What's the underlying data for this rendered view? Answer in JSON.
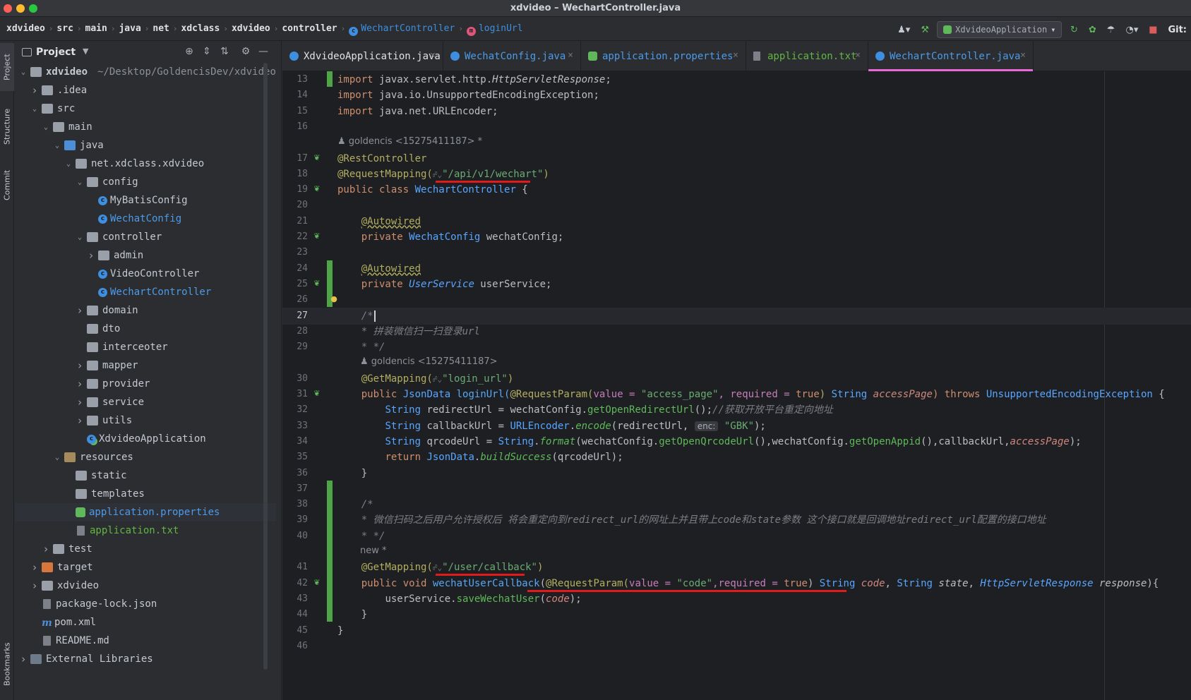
{
  "window": {
    "title": "xdvideo – WechartController.java"
  },
  "breadcrumb": [
    "xdvideo",
    "src",
    "main",
    "java",
    "net",
    "xdclass",
    "xdvideo",
    "controller",
    "WechartController",
    "loginUrl"
  ],
  "toolbar": {
    "run_config": "XdvideoApplication",
    "git_label": "Git:"
  },
  "toolstrip": {
    "project": "Project",
    "structure": "Structure",
    "commit": "Commit",
    "bookmarks": "Bookmarks"
  },
  "project_panel": {
    "title": "Project",
    "tree": [
      {
        "label": "xdvideo",
        "suffix": "~/Desktop/GoldencisDev/xdvideo",
        "depth": 0,
        "chevron": "down",
        "icon": "module-folder",
        "color": "normal"
      },
      {
        "label": ".idea",
        "depth": 1,
        "chevron": "right",
        "icon": "folder",
        "color": "normal"
      },
      {
        "label": "src",
        "depth": 1,
        "chevron": "down",
        "icon": "folder",
        "color": "normal"
      },
      {
        "label": "main",
        "depth": 2,
        "chevron": "down",
        "icon": "folder",
        "color": "normal"
      },
      {
        "label": "java",
        "depth": 3,
        "chevron": "down",
        "icon": "folder-blue",
        "color": "normal"
      },
      {
        "label": "net.xdclass.xdvideo",
        "depth": 4,
        "chevron": "down",
        "icon": "package",
        "color": "normal"
      },
      {
        "label": "config",
        "depth": 5,
        "chevron": "down",
        "icon": "package",
        "color": "normal"
      },
      {
        "label": "MyBatisConfig",
        "depth": 6,
        "chevron": "none",
        "icon": "class",
        "color": "normal"
      },
      {
        "label": "WechatConfig",
        "depth": 6,
        "chevron": "none",
        "icon": "class",
        "color": "blue"
      },
      {
        "label": "controller",
        "depth": 5,
        "chevron": "down",
        "icon": "package",
        "color": "normal"
      },
      {
        "label": "admin",
        "depth": 6,
        "chevron": "right",
        "icon": "package",
        "color": "normal"
      },
      {
        "label": "VideoController",
        "depth": 6,
        "chevron": "none",
        "icon": "class",
        "color": "normal"
      },
      {
        "label": "WechartController",
        "depth": 6,
        "chevron": "none",
        "icon": "class",
        "color": "blue"
      },
      {
        "label": "domain",
        "depth": 5,
        "chevron": "right",
        "icon": "package",
        "color": "normal"
      },
      {
        "label": "dto",
        "depth": 5,
        "chevron": "none",
        "icon": "package",
        "color": "normal"
      },
      {
        "label": "interceoter",
        "depth": 5,
        "chevron": "none",
        "icon": "package",
        "color": "normal"
      },
      {
        "label": "mapper",
        "depth": 5,
        "chevron": "right",
        "icon": "package",
        "color": "normal"
      },
      {
        "label": "provider",
        "depth": 5,
        "chevron": "right",
        "icon": "package",
        "color": "normal"
      },
      {
        "label": "service",
        "depth": 5,
        "chevron": "right",
        "icon": "package",
        "color": "normal"
      },
      {
        "label": "utils",
        "depth": 5,
        "chevron": "right",
        "icon": "package",
        "color": "normal"
      },
      {
        "label": "XdvideoApplication",
        "depth": 5,
        "chevron": "none",
        "icon": "spring-class",
        "color": "normal"
      },
      {
        "label": "resources",
        "depth": 3,
        "chevron": "down",
        "icon": "folder-res",
        "color": "normal"
      },
      {
        "label": "static",
        "depth": 4,
        "chevron": "none",
        "icon": "folder",
        "color": "normal"
      },
      {
        "label": "templates",
        "depth": 4,
        "chevron": "none",
        "icon": "folder",
        "color": "normal"
      },
      {
        "label": "application.properties",
        "depth": 4,
        "chevron": "none",
        "icon": "leaf",
        "color": "blue",
        "selected": true
      },
      {
        "label": "application.txt",
        "depth": 4,
        "chevron": "none",
        "icon": "file",
        "color": "green"
      },
      {
        "label": "test",
        "depth": 2,
        "chevron": "right",
        "icon": "folder",
        "color": "normal"
      },
      {
        "label": "target",
        "depth": 1,
        "chevron": "right",
        "icon": "folder-orange",
        "color": "normal"
      },
      {
        "label": "xdvideo",
        "depth": 1,
        "chevron": "right",
        "icon": "folder",
        "color": "normal"
      },
      {
        "label": "package-lock.json",
        "depth": 1,
        "chevron": "none",
        "icon": "file",
        "color": "normal"
      },
      {
        "label": "pom.xml",
        "depth": 1,
        "chevron": "none",
        "icon": "maven",
        "color": "normal"
      },
      {
        "label": "README.md",
        "depth": 1,
        "chevron": "none",
        "icon": "file",
        "color": "normal"
      },
      {
        "label": "External Libraries",
        "depth": 0,
        "chevron": "right",
        "icon": "library",
        "color": "normal"
      }
    ]
  },
  "tabs": [
    {
      "label": "XdvideoApplication.java",
      "icon": "spring-class",
      "color": "#dfe1e5"
    },
    {
      "label": "WechatConfig.java",
      "icon": "class",
      "color": "#4d9be8"
    },
    {
      "label": "application.properties",
      "icon": "leaf",
      "color": "#4d9be8"
    },
    {
      "label": "application.txt",
      "icon": "file",
      "color": "#62b543"
    },
    {
      "label": "WechartController.java",
      "icon": "class",
      "color": "#4d9be8",
      "active": true
    }
  ],
  "editor": {
    "current_line": 27,
    "author_hint_1": "goldencis <15275411187> *",
    "author_hint_2": "goldencis <15275411187>",
    "line_numbers": [
      "13",
      "14",
      "15",
      "16",
      "17",
      "18",
      "19",
      "20",
      "21",
      "22",
      "23",
      "24",
      "25",
      "26",
      "27",
      "28",
      "29",
      "30",
      "31",
      "32",
      "33",
      "34",
      "35",
      "36",
      "37",
      "38",
      "39",
      "40",
      "41",
      "42",
      "43",
      "44",
      "45",
      "46"
    ],
    "code": {
      "l13": "import javax.servlet.http.",
      "l13b": "HttpServletResponse",
      "l13c": ";",
      "l14": "import java.io.UnsupportedEncodingException;",
      "l15": "import java.net.URLEncoder;",
      "l17": "@RestController",
      "l18a": "@RequestMapping(",
      "l18b": "\"/api/v1/wechart\"",
      "l18c": ")",
      "l19a": "public class ",
      "l19b": "WechartController",
      "l19c": " {",
      "l21": "@Autowired",
      "l22a": "private ",
      "l22b": "WechatConfig",
      "l22c": " wechatConfig;",
      "l24": "@Autowired",
      "l25a": "private ",
      "l25b": "UserService",
      "l25c": " userService;",
      "l27": "/*",
      "l28": "* 拼装微信扫一扫登录url",
      "l29": "* */",
      "l30a": "@GetMapping(",
      "l30b": "\"login_url\"",
      "l30c": ")",
      "l31a": "public ",
      "l31b": "JsonData",
      "l31c": " loginUrl(",
      "l31d": "@RequestParam(",
      "l31e": "value = ",
      "l31f": "\"access_page\"",
      "l31g": ", required = ",
      "l31h": "true",
      "l31i": ") ",
      "l31j": "String",
      "l31k": " accessPage",
      "l31l": ") throws ",
      "l31m": "UnsupportedEncodingException",
      "l31n": " {",
      "l32a": "String",
      "l32b": " redirectUrl = wechatConfig.",
      "l32c": "getOpenRedirectUrl",
      "l32d": "();",
      "l32e": "//获取开放平台重定向地址",
      "l33a": "String",
      "l33b": " callbackUrl = ",
      "l33c": "URLEncoder",
      "l33d": ".",
      "l33e": "encode",
      "l33f": "(redirectUrl, ",
      "l33g": "enc:",
      "l33h": " \"GBK\"",
      "l33i": ");",
      "l34a": "String",
      "l34b": " qrcodeUrl = ",
      "l34c": "String",
      "l34d": ".",
      "l34e": "format",
      "l34f": "(wechatConfig.",
      "l34g": "getOpenQrcodeUrl",
      "l34h": "(),wechatConfig.",
      "l34i": "getOpenAppid",
      "l34j": "(),callbackUrl,",
      "l34k": "accessPage",
      "l34l": ");",
      "l35a": "return ",
      "l35b": "JsonData",
      "l35c": ".",
      "l35d": "buildSuccess",
      "l35e": "(qrcodeUrl);",
      "l36": "}",
      "l38": "/*",
      "l39a": "* 微信扫码之后用户允许授权后 将会重定向到",
      "l39b": "redirect_url",
      "l39c": "的网址上并且带上",
      "l39d": "code",
      "l39e": "和",
      "l39f": "state",
      "l39g": "参数 这个接口就是回调地址",
      "l39h": "redirect_url",
      "l39i": "配置的接口地址",
      "l40": "* */",
      "lnew": "new *",
      "l41a": "@GetMapping(",
      "l41b": "\"/user/callback\"",
      "l41c": ")",
      "l42a": "public void ",
      "l42b": "wechatUserCallback",
      "l42c": "(",
      "l42d": "@RequestParam(",
      "l42e": "value = ",
      "l42f": "\"code\"",
      "l42g": ",required = ",
      "l42h": "true",
      "l42i": ") ",
      "l42j": "String",
      "l42k": " code",
      "l42l": ", ",
      "l42m": "String",
      "l42n": " state",
      "l42o": ", ",
      "l42p": "HttpServletResponse",
      "l42q": " response",
      "l42r": "){",
      "l43a": "userService.",
      "l43b": "saveWechatUser",
      "l43c": "(",
      "l43d": "code",
      "l43e": ");",
      "l44": "}",
      "l45": "}"
    }
  }
}
